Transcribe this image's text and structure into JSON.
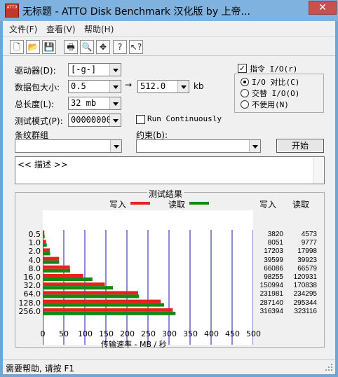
{
  "window": {
    "title": "无标题 - ATTO Disk Benchmark  汉化版 by 上帝...",
    "icon_label": "ATTO",
    "close_glyph": "✕"
  },
  "menu": [
    {
      "label": "文件(F)"
    },
    {
      "label": "查看(V)"
    },
    {
      "label": "帮助(H)"
    }
  ],
  "toolbar": [
    {
      "name": "new-icon",
      "glyph": "🗋"
    },
    {
      "name": "open-icon",
      "glyph": "📂"
    },
    {
      "name": "save-icon",
      "glyph": "💾"
    },
    {
      "name": "print-icon",
      "glyph": "🖶"
    },
    {
      "name": "print-preview-icon",
      "glyph": "🔍"
    },
    {
      "name": "move-icon",
      "glyph": "✥"
    },
    {
      "name": "help-icon",
      "glyph": "?"
    },
    {
      "name": "context-help-icon",
      "glyph": "↖?"
    }
  ],
  "form": {
    "drive_label": "驱动器(D):",
    "drive_value": "[-g-]",
    "transfer_label": "数据包大小:",
    "transfer_from": "0.5",
    "arrow": "→",
    "transfer_to": "512.0",
    "transfer_unit": "kb",
    "total_label": "总长度(L):",
    "total_value": "32 mb",
    "mode_label": "测试模式(P):",
    "mode_value": "00000000",
    "run_continuously": "Run Continuously",
    "stripe_label": "条纹群组",
    "constraint_label": "约束(b):",
    "queue_label": "指令 I/O(r)",
    "io_compare": "I/O 对比(C)",
    "overlapped_io": "交替 I/O(O)",
    "neither": "不使用(N)",
    "start_button": "开始",
    "description": "<< 描述 >>"
  },
  "results": {
    "group_title": "测试结果",
    "write_legend": "写入",
    "read_legend": "读取",
    "write_col": "写入",
    "read_col": "读取",
    "colors": {
      "write": "#e82020",
      "read": "#108a10",
      "grid": "#1a1aa8"
    }
  },
  "chart_data": {
    "type": "bar",
    "orientation": "horizontal",
    "categories": [
      "0.5",
      "1.0",
      "2.0",
      "4.0",
      "8.0",
      "16.0",
      "32.0",
      "64.0",
      "128.0",
      "256.0"
    ],
    "series": [
      {
        "name": "写入",
        "values": [
          3820,
          8051,
          17203,
          39599,
          66086,
          98255,
          150994,
          231981,
          287140,
          316394
        ]
      },
      {
        "name": "读取",
        "values": [
          4573,
          9777,
          17998,
          39923,
          66579,
          120931,
          170838,
          234295,
          295344,
          323116
        ]
      }
    ],
    "xlabel": "传输速率 - MB / 秒",
    "xlim": [
      0,
      500
    ],
    "xticks": [
      "0",
      "50",
      "100",
      "150",
      "200",
      "250",
      "300",
      "350",
      "400",
      "450",
      "500"
    ],
    "grid": true
  },
  "status": {
    "text": "需要帮助, 请按 F1"
  }
}
